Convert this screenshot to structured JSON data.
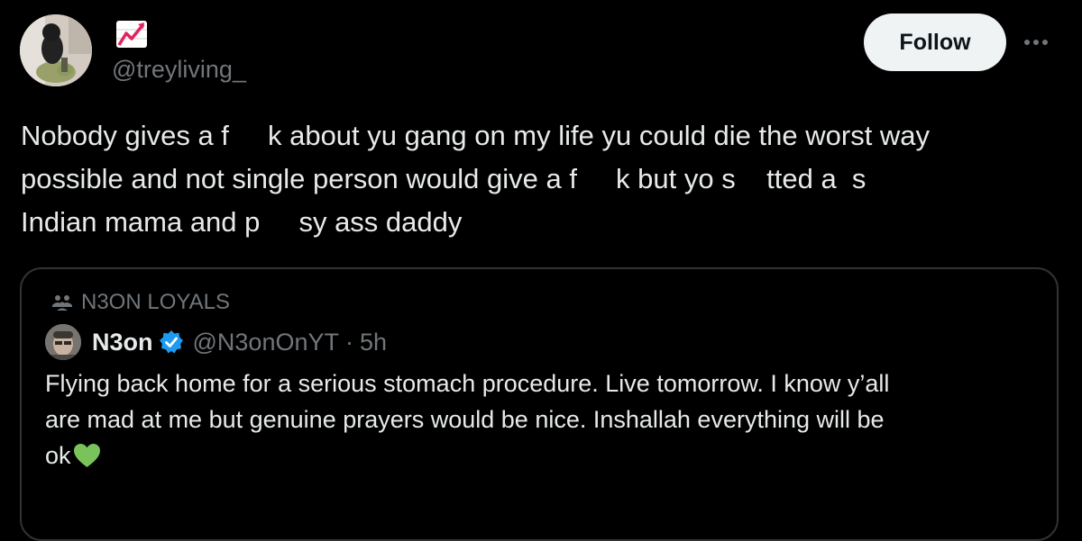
{
  "post": {
    "handle": "@treyliving_",
    "follow_label": "Follow",
    "user_emoji_icon": "chart-increasing-icon",
    "more_icon": "more-horizontal-icon",
    "text_lines": [
      "Nobody gives a f     k about yu gang on my life yu could die the worst way",
      "possible and not single person would give a f     k but yo s    tted a  s",
      "Indian mama and p     sy ass daddy"
    ]
  },
  "quote": {
    "community_icon": "community-icon",
    "community": "N3ON LOYALS",
    "name": "N3on",
    "handle": "@N3onOnYT",
    "separator": "·",
    "time": "5h",
    "verified_color": "#1d9bf0",
    "text_lines": [
      "Flying back home for a serious stomach procedure. Live tomorrow. I know y’all",
      "are mad at me but genuine prayers would be nice. Inshallah everything will be",
      "ok"
    ],
    "end_emoji_icon": "green-heart-icon",
    "end_emoji_color": "#79c35a"
  },
  "colors": {
    "background": "#000000",
    "primary_text": "#e7e9ea",
    "secondary_text": "#71767b",
    "border": "#2f3336",
    "button_bg": "#eff3f4",
    "button_text": "#0f1419"
  }
}
